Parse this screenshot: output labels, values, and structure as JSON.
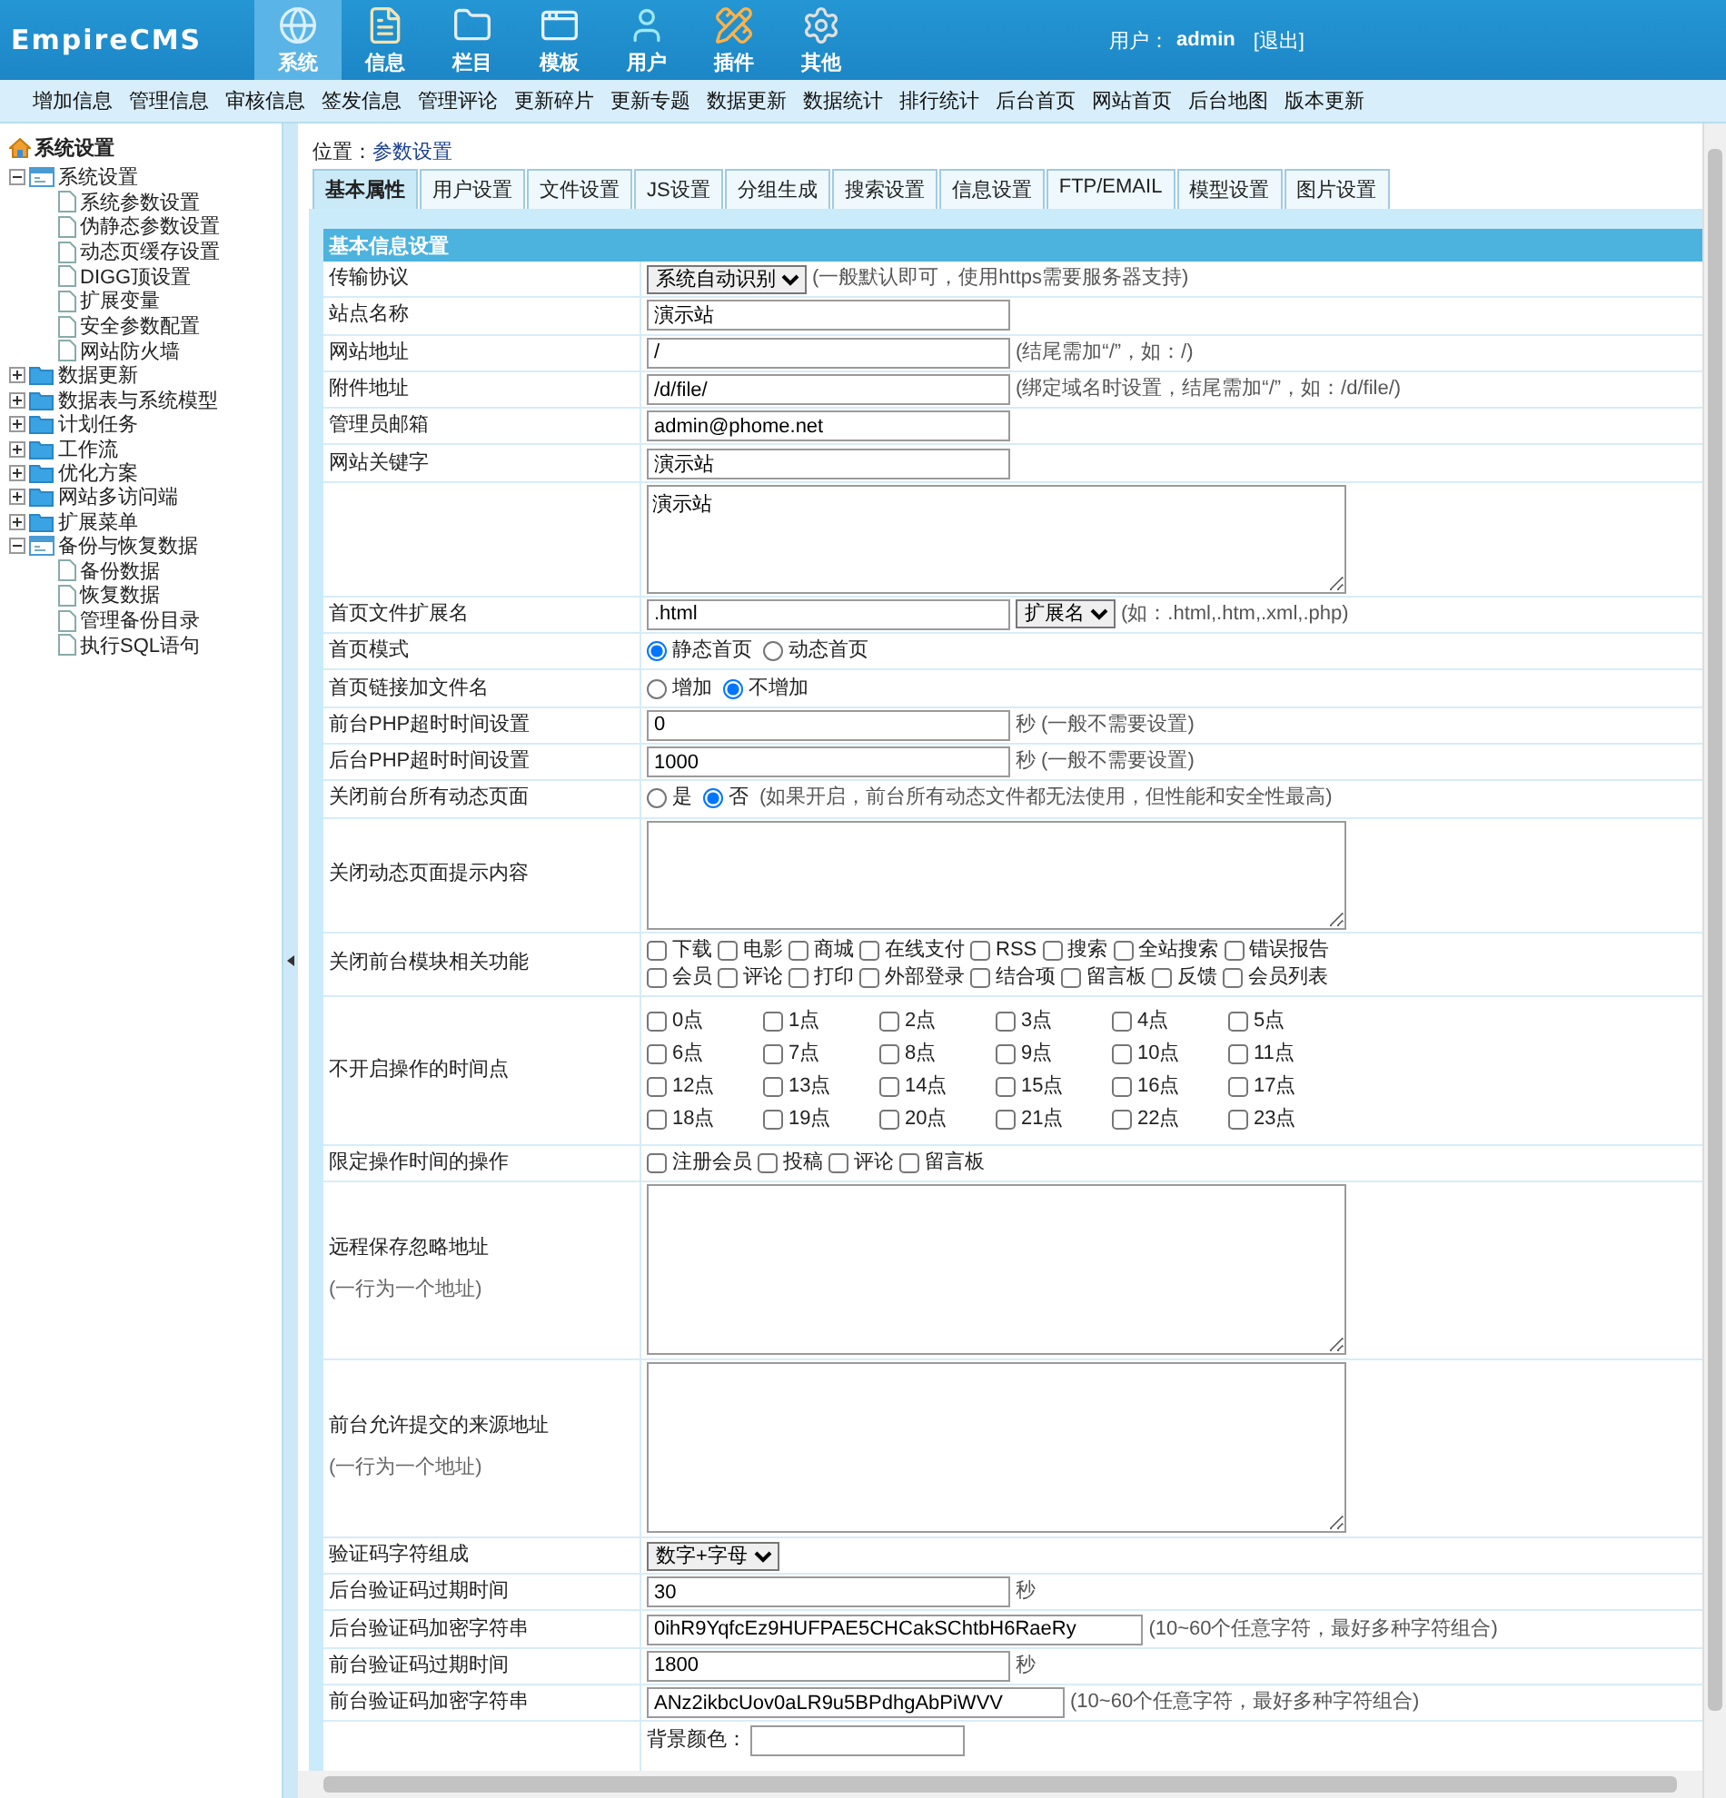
{
  "header": {
    "logo": "EmpireCMS",
    "user_label": "用户：",
    "user_name": "admin",
    "logout": "[退出]"
  },
  "nav": [
    {
      "label": "系统",
      "selected": true
    },
    {
      "label": "信息",
      "selected": false
    },
    {
      "label": "栏目",
      "selected": false
    },
    {
      "label": "模板",
      "selected": false
    },
    {
      "label": "用户",
      "selected": false
    },
    {
      "label": "插件",
      "selected": false
    },
    {
      "label": "其他",
      "selected": false
    }
  ],
  "menu": [
    "增加信息",
    "管理信息",
    "审核信息",
    "签发信息",
    "管理评论",
    "更新碎片",
    "更新专题",
    "数据更新",
    "数据统计",
    "排行统计",
    "后台首页",
    "网站首页",
    "后台地图",
    "版本更新"
  ],
  "sidebar": {
    "title": "系统设置",
    "groups": [
      {
        "label": "系统设置",
        "expanded": true,
        "children": [
          "系统参数设置",
          "伪静态参数设置",
          "动态页缓存设置",
          "DIGG顶设置",
          "扩展变量",
          "安全参数配置",
          "网站防火墙"
        ]
      },
      {
        "label": "数据更新",
        "expanded": false
      },
      {
        "label": "数据表与系统模型",
        "expanded": false
      },
      {
        "label": "计划任务",
        "expanded": false
      },
      {
        "label": "工作流",
        "expanded": false
      },
      {
        "label": "优化方案",
        "expanded": false
      },
      {
        "label": "网站多访问端",
        "expanded": false
      },
      {
        "label": "扩展菜单",
        "expanded": false
      },
      {
        "label": "备份与恢复数据",
        "expanded": true,
        "children": [
          "备份数据",
          "恢复数据",
          "管理备份目录",
          "执行SQL语句"
        ]
      }
    ]
  },
  "location": {
    "label": "位置：",
    "link": "参数设置"
  },
  "tabs": [
    {
      "label": "基本属性",
      "selected": true
    },
    {
      "label": "用户设置",
      "selected": false
    },
    {
      "label": "文件设置",
      "selected": false
    },
    {
      "label": "JS设置",
      "selected": false
    },
    {
      "label": "分组生成",
      "selected": false
    },
    {
      "label": "搜索设置",
      "selected": false
    },
    {
      "label": "信息设置",
      "selected": false
    },
    {
      "label": "FTP/EMAIL",
      "selected": false
    },
    {
      "label": "模型设置",
      "selected": false
    },
    {
      "label": "图片设置",
      "selected": false
    }
  ],
  "section_title": "基本信息设置",
  "rows": [
    {
      "kind": "select",
      "label": "传输协议",
      "value": "系统自动识别",
      "hint": "(一般默认即可，使用https需要服务器支持)"
    },
    {
      "kind": "text",
      "label": "站点名称",
      "value": "演示站"
    },
    {
      "kind": "text",
      "label": "网站地址",
      "value": "/",
      "hint": "(结尾需加“/”，如：/)"
    },
    {
      "kind": "text",
      "label": "附件地址",
      "value": "/d/file/",
      "hint": "(绑定域名时设置，结尾需加“/”，如：/d/file/)"
    },
    {
      "kind": "text",
      "label": "管理员邮箱",
      "value": "admin@phome.net"
    },
    {
      "kind": "text",
      "label": "网站关键字",
      "value": "演示站"
    },
    {
      "kind": "textarea",
      "value": "演示站"
    },
    {
      "kind": "text_select",
      "label": "首页文件扩展名",
      "value": ".html",
      "select": "扩展名",
      "hint": "(如：.html,.htm,.xml,.php)"
    },
    {
      "kind": "radio",
      "label": "首页模式",
      "options": [
        {
          "label": "静态首页",
          "selected": true
        },
        {
          "label": "动态首页",
          "selected": false
        }
      ]
    },
    {
      "kind": "radio",
      "label": "首页链接加文件名",
      "options": [
        {
          "label": "增加",
          "selected": false
        },
        {
          "label": "不增加",
          "selected": true
        }
      ]
    },
    {
      "kind": "text",
      "label": "前台PHP超时时间设置",
      "value": "0",
      "hint": "秒 (一般不需要设置)"
    },
    {
      "kind": "text",
      "label": "后台PHP超时时间设置",
      "value": "1000",
      "hint": "秒 (一般不需要设置)"
    },
    {
      "kind": "radio",
      "label": "关闭前台所有动态页面",
      "options": [
        {
          "label": "是",
          "selected": false
        },
        {
          "label": "否",
          "selected": true
        }
      ],
      "hint": "(如果开启，前台所有动态文件都无法使用，但性能和安全性最高)"
    },
    {
      "kind": "textarea",
      "label": "关闭动态页面提示内容"
    },
    {
      "kind": "checkboxes",
      "label": "关闭前台模块相关功能",
      "items": [
        {
          "label": "下载",
          "checked": false
        },
        {
          "label": "电影",
          "checked": false
        },
        {
          "label": "商城",
          "checked": false
        },
        {
          "label": "在线支付",
          "checked": false
        },
        {
          "label": "RSS",
          "checked": false
        },
        {
          "label": "搜索",
          "checked": false
        },
        {
          "label": "全站搜索",
          "checked": false
        },
        {
          "label": "错误报告",
          "checked": false
        },
        {
          "label": "会员",
          "checked": false
        },
        {
          "label": "评论",
          "checked": false
        },
        {
          "label": "打印",
          "checked": false
        },
        {
          "label": "外部登录",
          "checked": false
        },
        {
          "label": "结合项",
          "checked": false
        },
        {
          "label": "留言板",
          "checked": false
        },
        {
          "label": "反馈",
          "checked": false
        },
        {
          "label": "会员列表",
          "checked": false
        }
      ]
    },
    {
      "kind": "hours",
      "label": "不开启操作的时间点",
      "items": [
        {
          "label": "0点",
          "checked": false
        },
        {
          "label": "1点",
          "checked": false
        },
        {
          "label": "2点",
          "checked": false
        },
        {
          "label": "3点",
          "checked": false
        },
        {
          "label": "4点",
          "checked": false
        },
        {
          "label": "5点",
          "checked": false
        },
        {
          "label": "6点",
          "checked": false
        },
        {
          "label": "7点",
          "checked": false
        },
        {
          "label": "8点",
          "checked": false
        },
        {
          "label": "9点",
          "checked": false
        },
        {
          "label": "10点",
          "checked": false
        },
        {
          "label": "11点",
          "checked": false
        },
        {
          "label": "12点",
          "checked": false
        },
        {
          "label": "13点",
          "checked": false
        },
        {
          "label": "14点",
          "checked": false
        },
        {
          "label": "15点",
          "checked": false
        },
        {
          "label": "16点",
          "checked": false
        },
        {
          "label": "17点",
          "checked": false
        },
        {
          "label": "18点",
          "checked": false
        },
        {
          "label": "19点",
          "checked": false
        },
        {
          "label": "20点",
          "checked": false
        },
        {
          "label": "21点",
          "checked": false
        },
        {
          "label": "22点",
          "checked": false
        },
        {
          "label": "23点",
          "checked": false
        }
      ]
    },
    {
      "kind": "checkboxes",
      "label": "限定操作时间的操作",
      "items": [
        {
          "label": "注册会员",
          "checked": false
        },
        {
          "label": "投稿",
          "checked": false
        },
        {
          "label": "评论",
          "checked": false
        },
        {
          "label": "留言板",
          "checked": false
        }
      ]
    },
    {
      "kind": "textarea_tall",
      "label": "远程保存忽略地址",
      "note": "(一行为一个地址)"
    },
    {
      "kind": "textarea_tall",
      "label": "前台允许提交的来源地址",
      "note": "(一行为一个地址)"
    },
    {
      "kind": "select",
      "label": "验证码字符组成",
      "value": "数字+字母"
    },
    {
      "kind": "text",
      "label": "后台验证码过期时间",
      "value": "30",
      "hint": "秒"
    },
    {
      "kind": "text",
      "label": "后台验证码加密字符串",
      "value": "0ihR9YqfcEz9HUFPAE5CHCakSChtbH6RaeRy",
      "hint": "(10~60个任意字符，最好多种字符组合)"
    },
    {
      "kind": "text",
      "label": "前台验证码过期时间",
      "value": "1800",
      "hint": "秒"
    },
    {
      "kind": "text",
      "label": "前台验证码加密字符串",
      "value": "ANz2ikbcUov0aLR9u5BPdhgAbPiWVV",
      "hint": "(10~60个任意字符，最好多种字符组合)"
    },
    {
      "kind": "color",
      "field_label": "背景颜色："
    }
  ]
}
